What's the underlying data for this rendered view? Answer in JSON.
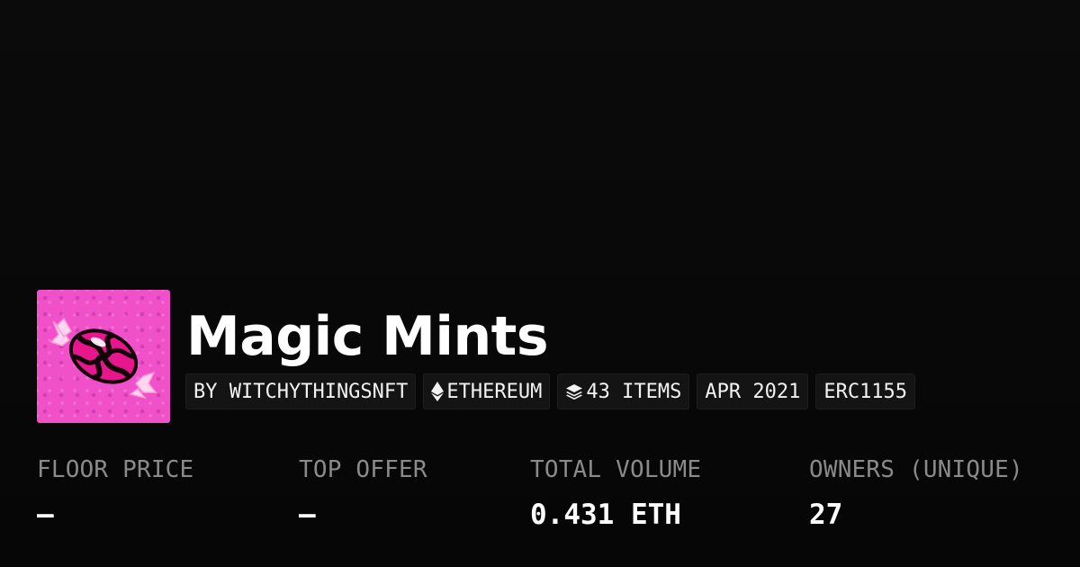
{
  "collection": {
    "title": "Magic Mints",
    "thumbnail_icon": "mint-candy-icon"
  },
  "chips": [
    {
      "label": "BY WITCHYTHINGSNFT"
    },
    {
      "label": "ETHEREUM",
      "icon": "ethereum-icon"
    },
    {
      "label": "43 ITEMS",
      "icon": "layers-icon"
    },
    {
      "label": "APR 2021"
    },
    {
      "label": "ERC1155"
    }
  ],
  "stats": [
    {
      "label": "FLOOR PRICE",
      "value": "–"
    },
    {
      "label": "TOP OFFER",
      "value": "–"
    },
    {
      "label": "TOTAL VOLUME",
      "value": "0.431 ETH"
    },
    {
      "label": "OWNERS (UNIQUE)",
      "value": "27"
    }
  ],
  "colors": {
    "background": "#0a0a0a",
    "thumbnail_pink": "#f050c8",
    "candy_magenta": "#e8168c",
    "label_gray": "#8a8a8a"
  }
}
